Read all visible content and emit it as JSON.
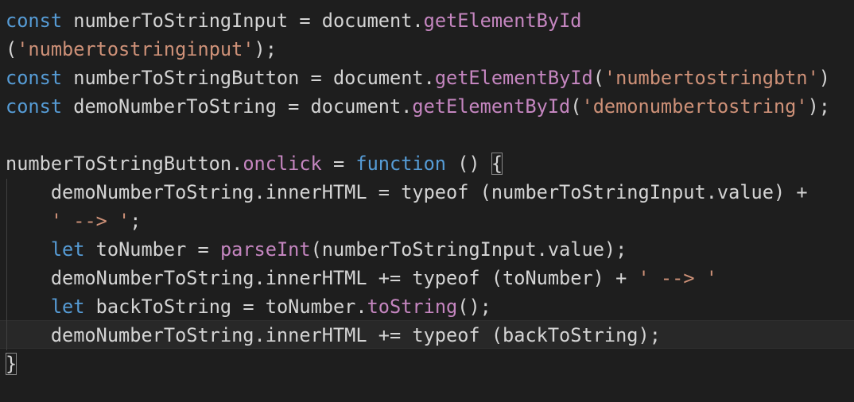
{
  "colors": {
    "background": "#1e1e1e",
    "keyword": "#569cd6",
    "method": "#c586c0",
    "string": "#ce9178",
    "plain": "#d4d4d4"
  },
  "code_lines": [
    [
      {
        "t": "const",
        "c": "kw"
      },
      {
        "t": " numberToStringInput ",
        "c": "var"
      },
      {
        "t": "=",
        "c": "op"
      },
      {
        "t": " document.",
        "c": "var"
      },
      {
        "t": "getElementById",
        "c": "fn"
      }
    ],
    [
      {
        "t": "(",
        "c": "punc"
      },
      {
        "t": "'numbertostringinput'",
        "c": "str"
      },
      {
        "t": ");",
        "c": "punc"
      }
    ],
    [
      {
        "t": "const",
        "c": "kw"
      },
      {
        "t": " numberToStringButton ",
        "c": "var"
      },
      {
        "t": "=",
        "c": "op"
      },
      {
        "t": " document.",
        "c": "var"
      },
      {
        "t": "getElementById",
        "c": "fn"
      },
      {
        "t": "(",
        "c": "punc"
      },
      {
        "t": "'numbertostringbtn'",
        "c": "str"
      },
      {
        "t": ")",
        "c": "punc"
      }
    ],
    [
      {
        "t": "const",
        "c": "kw"
      },
      {
        "t": " demoNumberToString ",
        "c": "var"
      },
      {
        "t": "=",
        "c": "op"
      },
      {
        "t": " document.",
        "c": "var"
      },
      {
        "t": "getElementById",
        "c": "fn"
      },
      {
        "t": "(",
        "c": "punc"
      },
      {
        "t": "'demonumbertostring'",
        "c": "str"
      },
      {
        "t": ");",
        "c": "punc"
      }
    ],
    [],
    [
      {
        "t": "numberToStringButton.",
        "c": "var"
      },
      {
        "t": "onclick",
        "c": "fn"
      },
      {
        "t": " = ",
        "c": "op"
      },
      {
        "t": "function",
        "c": "kw"
      },
      {
        "t": " () ",
        "c": "punc"
      },
      {
        "t": "{",
        "c": "punc",
        "match": true
      }
    ],
    [
      {
        "t": "    demoNumberToString.innerHTML ",
        "c": "var"
      },
      {
        "t": "=",
        "c": "op"
      },
      {
        "t": " typeof (numberToStringInput.value) ",
        "c": "var"
      },
      {
        "t": "+",
        "c": "op"
      }
    ],
    [
      {
        "t": "    ",
        "c": "var"
      },
      {
        "t": "' --> '",
        "c": "str"
      },
      {
        "t": ";",
        "c": "punc"
      }
    ],
    [
      {
        "t": "    ",
        "c": "var"
      },
      {
        "t": "let",
        "c": "kw"
      },
      {
        "t": " toNumber ",
        "c": "var"
      },
      {
        "t": "=",
        "c": "op"
      },
      {
        "t": " ",
        "c": "var"
      },
      {
        "t": "parseInt",
        "c": "fn"
      },
      {
        "t": "(numberToStringInput.value);",
        "c": "var"
      }
    ],
    [
      {
        "t": "    demoNumberToString.innerHTML ",
        "c": "var"
      },
      {
        "t": "+=",
        "c": "op"
      },
      {
        "t": " typeof (toNumber) ",
        "c": "var"
      },
      {
        "t": "+",
        "c": "op"
      },
      {
        "t": " ",
        "c": "var"
      },
      {
        "t": "' --> '",
        "c": "str"
      }
    ],
    [
      {
        "t": "    ",
        "c": "var"
      },
      {
        "t": "let",
        "c": "kw"
      },
      {
        "t": " backToString ",
        "c": "var"
      },
      {
        "t": "=",
        "c": "op"
      },
      {
        "t": " toNumber.",
        "c": "var"
      },
      {
        "t": "toString",
        "c": "fn"
      },
      {
        "t": "();",
        "c": "punc"
      }
    ],
    [
      {
        "t": "    demoNumberToString.innerHTML ",
        "c": "var"
      },
      {
        "t": "+=",
        "c": "op"
      },
      {
        "t": " typeof (backToString);",
        "c": "var"
      }
    ],
    [
      {
        "t": "}",
        "c": "punc",
        "match": true
      }
    ]
  ]
}
